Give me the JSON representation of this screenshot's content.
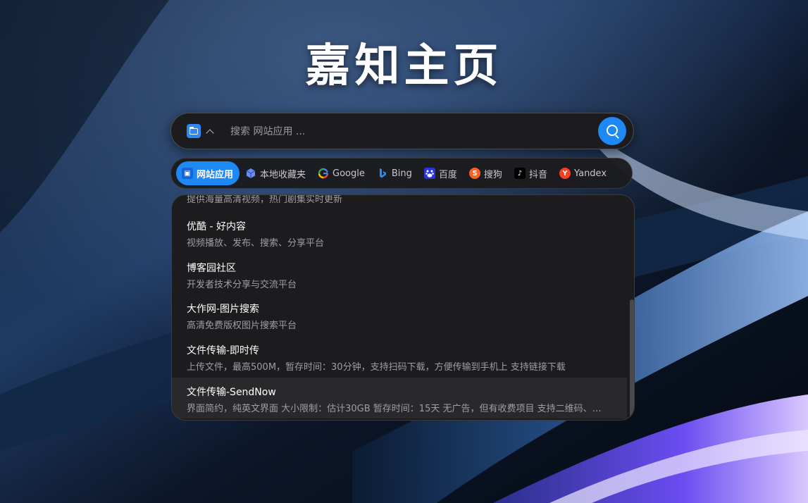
{
  "page_title": "嘉知主页",
  "search": {
    "placeholder": "搜索 网站应用 ...",
    "value": ""
  },
  "tabs": [
    {
      "label": "网站应用",
      "icon": "app-folder-icon",
      "active": true
    },
    {
      "label": "本地收藏夹",
      "icon": "cube-icon"
    },
    {
      "label": "Google",
      "icon": "google-icon"
    },
    {
      "label": "Bing",
      "icon": "bing-icon"
    },
    {
      "label": "百度",
      "icon": "baidu-icon"
    },
    {
      "label": "搜狗",
      "icon": "sogou-icon"
    },
    {
      "label": "抖音",
      "icon": "douyin-icon"
    },
    {
      "label": "Yandex",
      "icon": "yandex-icon"
    }
  ],
  "dropdown": {
    "partial_line": "提供海量高清视频，热门剧集实时更新",
    "items": [
      {
        "title": "优酷 - 好内容",
        "desc": "视频播放、发布、搜索、分享平台"
      },
      {
        "title": "博客园社区",
        "desc": "开发者技术分享与交流平台"
      },
      {
        "title": "大作网-图片搜索",
        "desc": "高清免费版权图片搜索平台"
      },
      {
        "title": "文件传输-即时传",
        "desc": "上传文件，最高500M，暂存时间：30分钟，支持扫码下载，方便传输到手机上 支持链接下载"
      },
      {
        "title": "文件传输-SendNow",
        "desc": "界面简约，纯英文界面 大小限制：估计30GB 暂存时间：15天 无广告，但有收费项目 支持二维码、链接下载",
        "highlighted": true
      }
    ]
  },
  "colors": {
    "accent": "#1e88f5",
    "panel": "#1c1c1f"
  }
}
